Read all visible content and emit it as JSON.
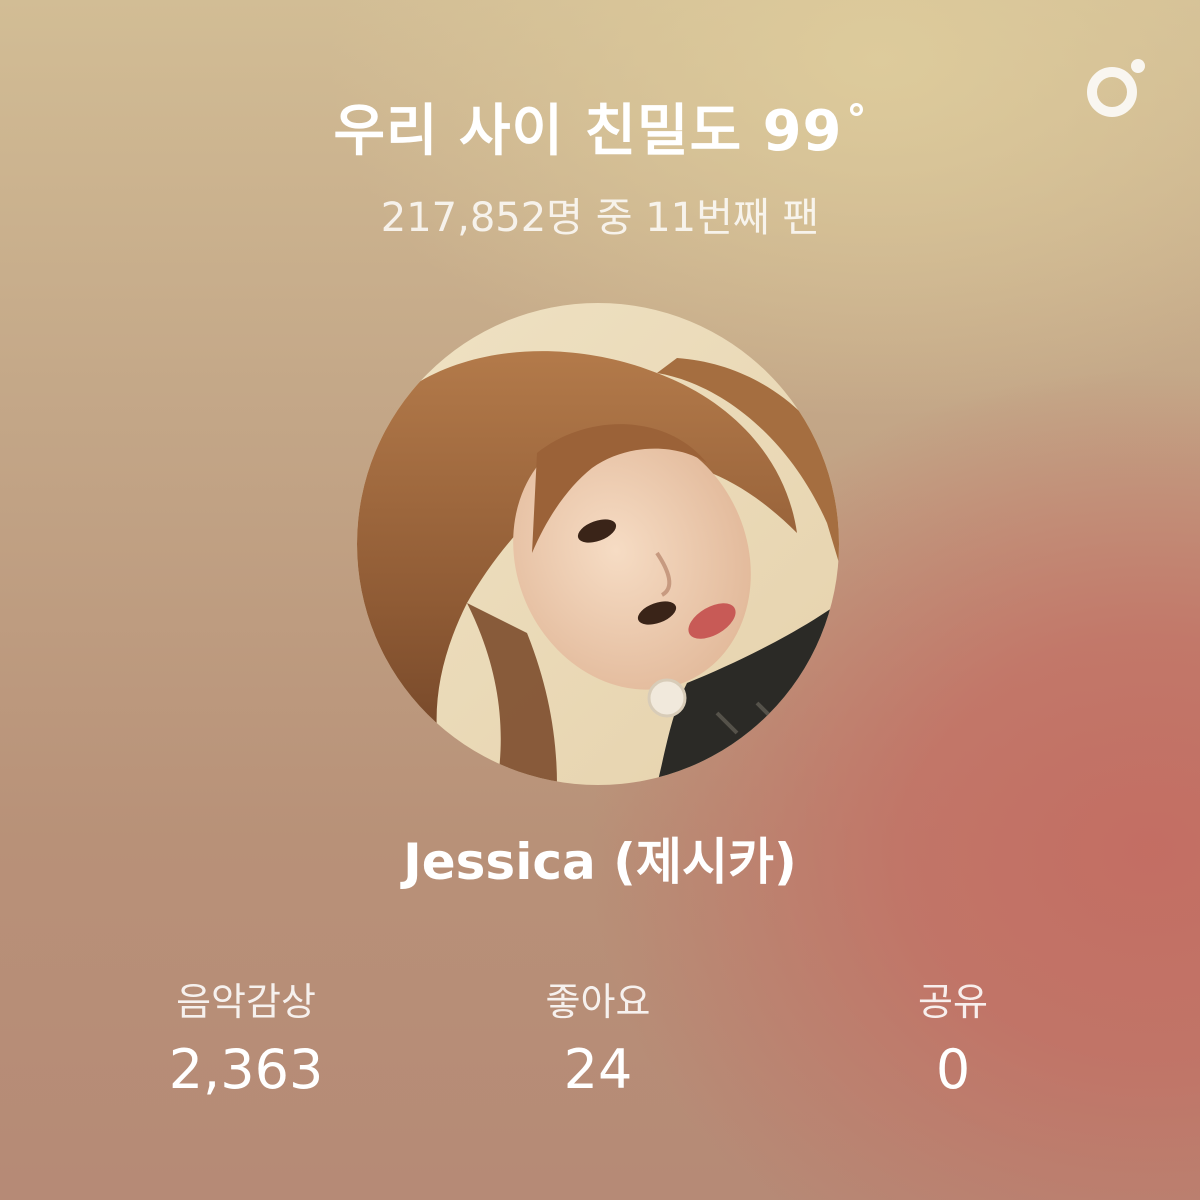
{
  "logo": {
    "icon": "brand-logo-icon"
  },
  "header": {
    "title": "우리 사이 친밀도 99",
    "degree_symbol": "°",
    "subtitle": "217,852명 중 11번째 팬"
  },
  "artist": {
    "name": "Jessica (제시카)",
    "photo": "artist-portrait"
  },
  "stats": [
    {
      "label": "음악감상",
      "value": "2,363"
    },
    {
      "label": "좋아요",
      "value": "24"
    },
    {
      "label": "공유",
      "value": "0"
    }
  ],
  "colors": {
    "text": "#ffffff",
    "background_top": "#d2bd95",
    "background_accent": "#c46c62"
  }
}
